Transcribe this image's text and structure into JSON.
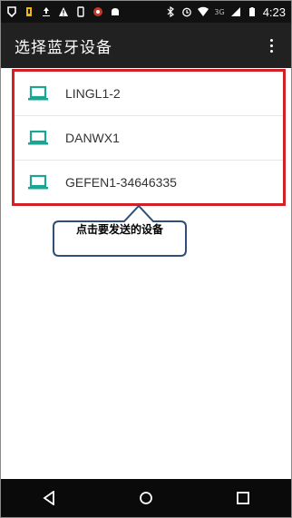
{
  "status_bar": {
    "time": "4:23",
    "network": "3G",
    "left_icons": [
      "shield-icon",
      "battery-saver-icon",
      "upload-icon",
      "warning-icon",
      "phone-icon",
      "record-icon",
      "android-icon"
    ],
    "right_icons": [
      "bluetooth-icon",
      "alarm-icon",
      "wifi-icon",
      "signal-icon",
      "battery-icon"
    ]
  },
  "app_bar": {
    "title": "选择蓝牙设备",
    "menu_icon": "overflow-menu-icon"
  },
  "devices": [
    {
      "name": "LINGL1-2",
      "icon": "laptop-icon"
    },
    {
      "name": "DANWX1",
      "icon": "laptop-icon"
    },
    {
      "name": "GEFEN1-34646335",
      "icon": "laptop-icon"
    }
  ],
  "callout": {
    "text": "点击要发送的设备"
  },
  "nav_bar": {
    "buttons": [
      "back-icon",
      "home-icon",
      "recents-icon"
    ]
  },
  "colors": {
    "highlight": "#d32027",
    "accent": "#1aa692",
    "callout_border": "#2f4f7a",
    "app_bar": "#212121"
  }
}
